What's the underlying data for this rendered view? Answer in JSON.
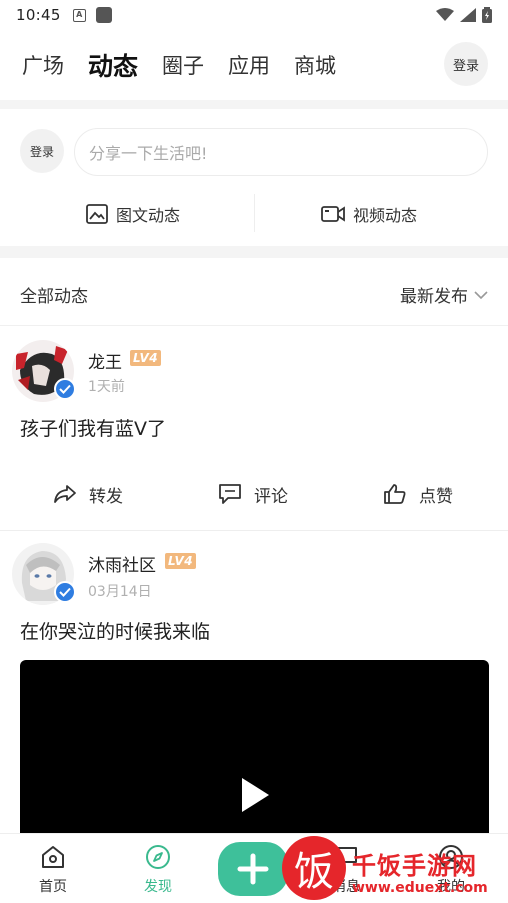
{
  "status_bar": {
    "time": "10:45"
  },
  "top_tabs": [
    {
      "label": "广场",
      "active": false
    },
    {
      "label": "动态",
      "active": true
    },
    {
      "label": "圈子",
      "active": false
    },
    {
      "label": "应用",
      "active": false
    },
    {
      "label": "商城",
      "active": false
    }
  ],
  "header": {
    "login_label": "登录"
  },
  "composer": {
    "avatar_label": "登录",
    "placeholder": "分享一下生活吧!",
    "image_post_label": "图文动态",
    "video_post_label": "视频动态"
  },
  "filter": {
    "all_label": "全部动态",
    "sort_label": "最新发布"
  },
  "posts": [
    {
      "username": "龙王",
      "level": "LV4",
      "time": "1天前",
      "content": "孩子们我有蓝V了",
      "actions": {
        "repost": "转发",
        "comment": "评论",
        "like": "点赞"
      }
    },
    {
      "username": "沐雨社区",
      "level": "LV4",
      "time": "03月14日",
      "content": "在你哭泣的时候我来临"
    }
  ],
  "bottom_nav": [
    {
      "label": "首页",
      "icon": "home-icon",
      "active": false
    },
    {
      "label": "发现",
      "icon": "compass-icon",
      "active": true
    },
    {
      "label": "消息",
      "icon": "message-icon",
      "active": false
    },
    {
      "label": "我的",
      "icon": "profile-icon",
      "active": false
    }
  ],
  "watermark": {
    "logo_char": "饭",
    "title": "千饭手游网",
    "url": "www.eduext.com"
  },
  "colors": {
    "accent": "#3ec09a",
    "verified": "#2f7de1",
    "level_badge": "#f2b87d",
    "watermark": "#e5262b"
  }
}
